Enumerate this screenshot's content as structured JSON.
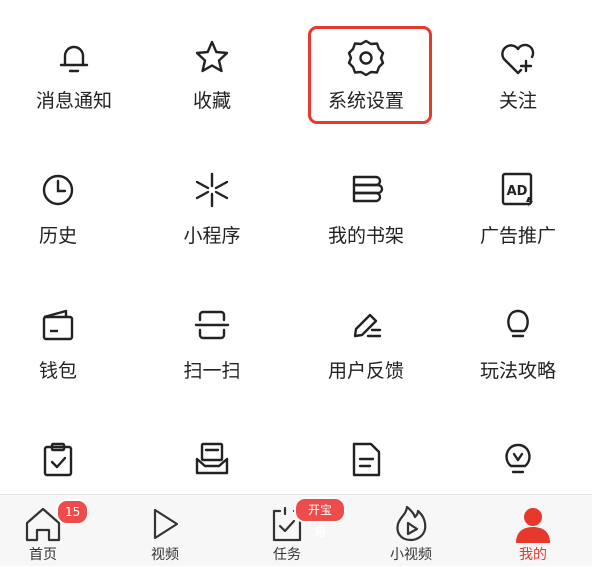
{
  "menu_rows": [
    [
      {
        "label": "消息通知",
        "icon": "bell-icon"
      },
      {
        "label": "收藏",
        "icon": "star-icon"
      },
      {
        "label": "系统设置",
        "icon": "gear-icon"
      },
      {
        "label": "关注",
        "icon": "heart-plus-icon"
      }
    ],
    [
      {
        "label": "历史",
        "icon": "clock-icon"
      },
      {
        "label": "小程序",
        "icon": "mini-program-icon"
      },
      {
        "label": "我的书架",
        "icon": "bookshelf-icon"
      },
      {
        "label": "广告推广",
        "icon": "ad-icon"
      }
    ],
    [
      {
        "label": "钱包",
        "icon": "wallet-icon"
      },
      {
        "label": "扫一扫",
        "icon": "scan-icon"
      },
      {
        "label": "用户反馈",
        "icon": "feedback-pen-icon"
      },
      {
        "label": "玩法攻略",
        "icon": "bulb-icon"
      }
    ],
    [
      {
        "label": "",
        "icon": "clipboard-check-icon"
      },
      {
        "label": "",
        "icon": "inbox-mail-icon"
      },
      {
        "label": "",
        "icon": "document-icon"
      },
      {
        "label": "",
        "icon": "bulb-tip-icon"
      }
    ]
  ],
  "highlight_color": "#e8372b",
  "tabs": [
    {
      "label": "首页",
      "icon": "home-icon",
      "badge": "15"
    },
    {
      "label": "视频",
      "icon": "play-icon"
    },
    {
      "label": "任务",
      "icon": "task-icon",
      "badge": "开宝箱"
    },
    {
      "label": "小视频",
      "icon": "flame-play-icon"
    },
    {
      "label": "我的",
      "icon": "person-icon",
      "active": true
    }
  ],
  "active_color": "#e8372b",
  "badge_color": "#ee4c4a"
}
